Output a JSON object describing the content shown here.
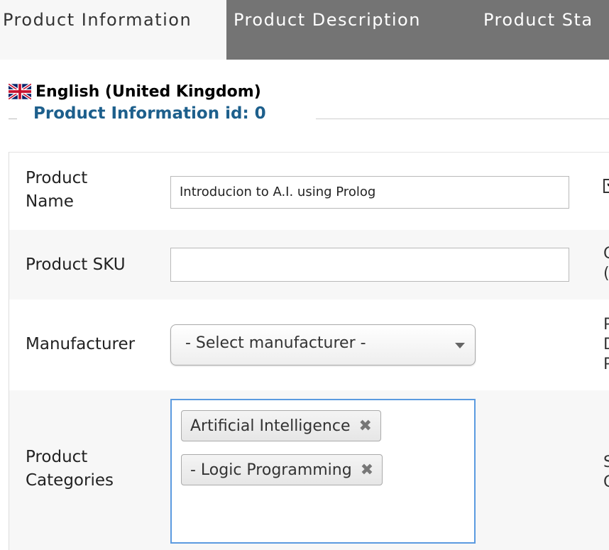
{
  "tabs": {
    "active": "Product Information",
    "description": "Product Description",
    "status": "Product Sta"
  },
  "language": {
    "label": "English (United Kingdom)",
    "flag_icon": "uk-flag-icon"
  },
  "fieldset": {
    "legend": "Product Information id: 0"
  },
  "fields": {
    "product_name": {
      "label_line1": "Product",
      "label_line2": "Name",
      "value": "Introducion to A.I. using Prolog",
      "checked": true
    },
    "product_sku": {
      "label": "Product SKU",
      "value": ""
    },
    "manufacturer": {
      "label": "Manufacturer",
      "selected": "- Select manufacturer -"
    },
    "categories": {
      "label_line1": "Product",
      "label_line2": "Categories",
      "chips": [
        "Artificial Intelligence",
        "- Logic Programming"
      ],
      "remove_glyph": "✖"
    }
  },
  "right_column": {
    "row2": [
      "G",
      "(E"
    ],
    "row3": [
      "P",
      "D",
      "P"
    ],
    "row4": [
      "S",
      "G"
    ]
  },
  "colors": {
    "legend": "#1d5f8c",
    "inactive_tab": "#747474",
    "focus_border": "#5b9ae0"
  }
}
